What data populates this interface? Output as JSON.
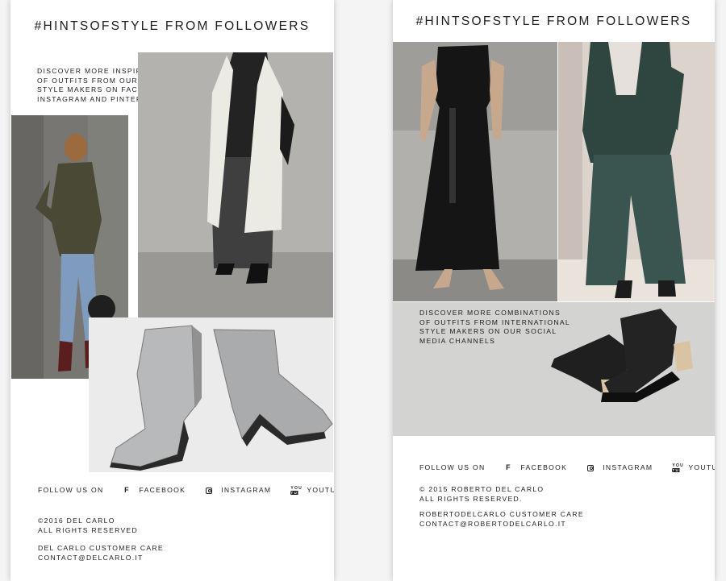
{
  "left_email": {
    "title": "#HINTSOFSTYLE FROM FOLLOWERS",
    "intro_lines": [
      "DISCOVER MORE INSPIRATIONS",
      "OF OUTFITS FROM OUR FAVORITE",
      "STYLE MAKERS ON FACEBOOK",
      "INSTAGRAM AND PINTEREST"
    ],
    "follow_label": "FOLLOW US ON",
    "social": [
      {
        "icon": "facebook-icon",
        "label": "FACEBOOK"
      },
      {
        "icon": "instagram-icon",
        "label": "INSTAGRAM"
      },
      {
        "icon": "youtube-icon",
        "label": "YOUTUBE"
      }
    ],
    "copyright_lines": [
      "©2016 DEL CARLO",
      "ALL RIGHTS RESERVED"
    ],
    "care_lines": [
      "DEL CARLO CUSTOMER CARE",
      "CONTACT@DELCARLO.IT"
    ]
  },
  "right_email": {
    "title": "#HINTSOFSTYLE FROM FOLLOWERS",
    "intro_lines": [
      "DISCOVER MORE COMBINATIONS",
      "OF OUTFITS FROM INTERNATIONAL",
      "STYLE MAKERS ON OUR SOCIAL",
      "MEDIA CHANNELS"
    ],
    "follow_label": "FOLLOW US ON",
    "social": [
      {
        "icon": "facebook-icon",
        "label": "FACEBOOK"
      },
      {
        "icon": "instagram-icon",
        "label": "INSTAGRAM"
      },
      {
        "icon": "youtube-icon",
        "label": "YOUTUBE"
      }
    ],
    "copyright_lines": [
      "© 2015 ROBERTO DEL CARLO",
      "ALL RIGHTS RESERVED."
    ],
    "care_lines": [
      "ROBERTODELCARLO CUSTOMER CARE",
      "CONTACT@ROBERTODELCARLO.IT"
    ]
  },
  "youtube_glyph": {
    "top": "You",
    "bottom": "Tube"
  },
  "facebook_glyph": "f",
  "colors": {
    "card": "#ffffff",
    "text": "#1c1c1c",
    "page": "#f4f4f4"
  }
}
